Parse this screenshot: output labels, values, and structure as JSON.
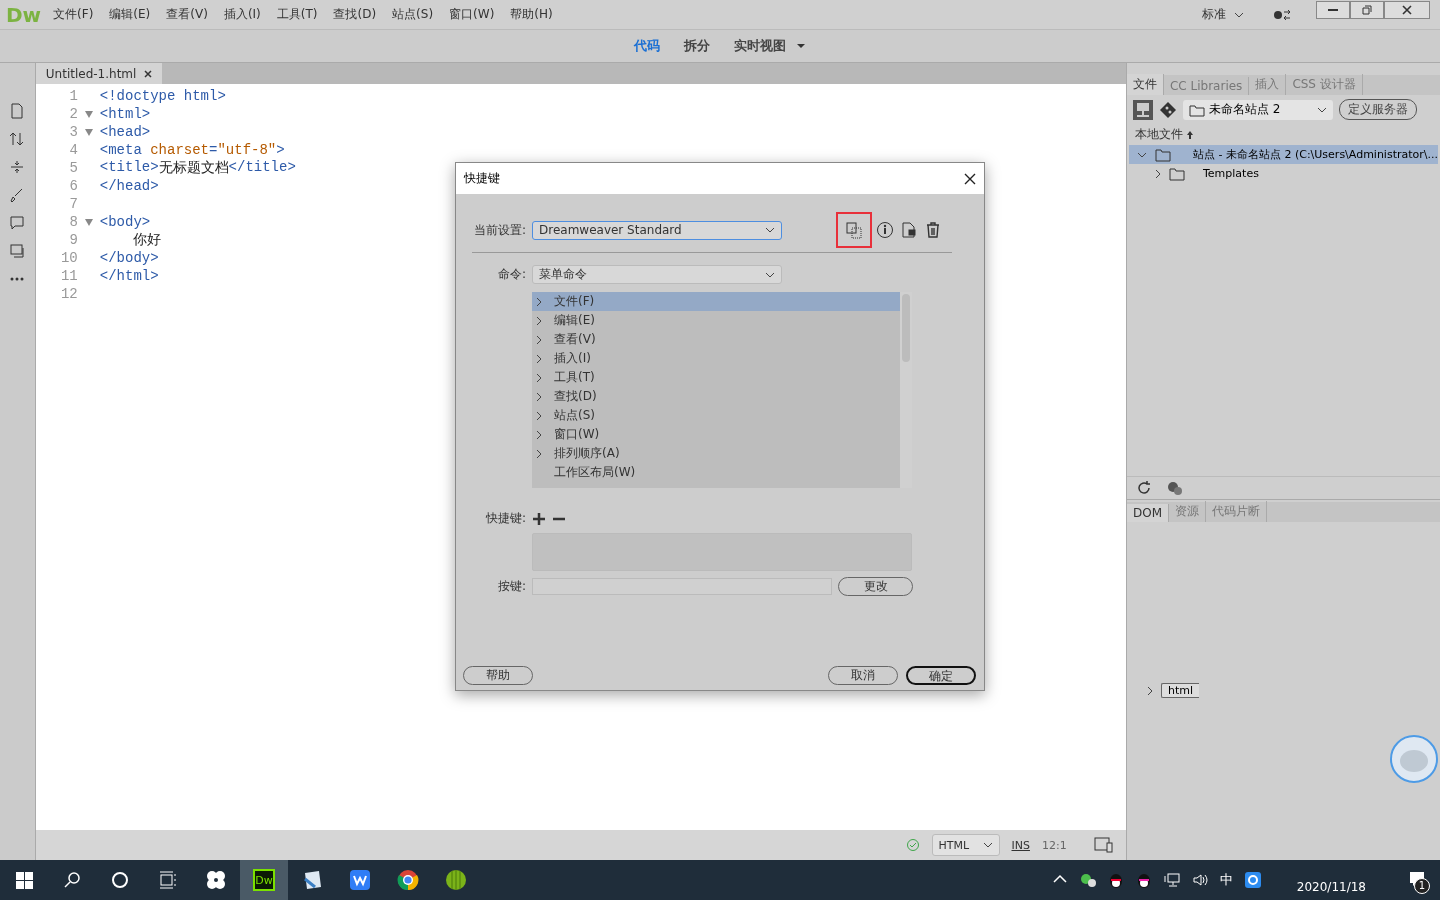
{
  "app": {
    "logo": "Dw",
    "menu": [
      "文件(F)",
      "编辑(E)",
      "查看(V)",
      "插入(I)",
      "工具(T)",
      "查找(D)",
      "站点(S)",
      "窗口(W)",
      "帮助(H)"
    ],
    "workspace": "标准"
  },
  "view_switch": [
    {
      "label": "代码",
      "selected": true
    },
    {
      "label": "拆分",
      "selected": false
    },
    {
      "label": "实时视图",
      "selected": false
    }
  ],
  "document_tab": {
    "title": "Untitled-1.html"
  },
  "code_lines": [
    {
      "number": "1",
      "foldable": false,
      "tokens": [
        {
          "kind": "tag",
          "text": "<!doctype html>"
        }
      ]
    },
    {
      "number": "2",
      "foldable": true,
      "tokens": [
        {
          "kind": "tag",
          "text": "<html>"
        }
      ]
    },
    {
      "number": "3",
      "foldable": true,
      "tokens": [
        {
          "kind": "tag",
          "text": "<head>"
        }
      ]
    },
    {
      "number": "4",
      "foldable": false,
      "tokens": [
        {
          "kind": "tag",
          "text": "<meta "
        },
        {
          "kind": "attr",
          "text": "charset"
        },
        {
          "kind": "tag",
          "text": "="
        },
        {
          "kind": "value",
          "text": "\"utf-8\""
        },
        {
          "kind": "tag",
          "text": ">"
        }
      ]
    },
    {
      "number": "5",
      "foldable": false,
      "tokens": [
        {
          "kind": "tag",
          "text": "<title>"
        },
        {
          "kind": "text",
          "text": "无标题文档"
        },
        {
          "kind": "tag",
          "text": "</title>"
        }
      ]
    },
    {
      "number": "6",
      "foldable": false,
      "tokens": [
        {
          "kind": "tag",
          "text": "</head>"
        }
      ]
    },
    {
      "number": "7",
      "foldable": false
    },
    {
      "number": "8",
      "foldable": true,
      "tokens": [
        {
          "kind": "tag",
          "text": "<body>"
        }
      ]
    },
    {
      "number": "9",
      "foldable": false,
      "tokens": [
        {
          "kind": "text",
          "text": "    你好"
        }
      ]
    },
    {
      "number": "10",
      "foldable": false,
      "tokens": [
        {
          "kind": "tag",
          "text": "</body>"
        }
      ]
    },
    {
      "number": "11",
      "foldable": false,
      "tokens": [
        {
          "kind": "tag",
          "text": "</html>"
        }
      ]
    },
    {
      "number": "12",
      "foldable": false
    }
  ],
  "status_bar": {
    "language": "HTML",
    "mode": "INS",
    "position": "12:1"
  },
  "files_panel": {
    "tabs": [
      {
        "label": "文件",
        "selected": true
      },
      {
        "label": "CC Libraries",
        "selected": false
      },
      {
        "label": "插入",
        "selected": false
      },
      {
        "label": "CSS 设计器",
        "selected": false
      }
    ],
    "site": "未命名站点 2",
    "define_server": "定义服务器",
    "header": "本地文件",
    "tree": [
      {
        "label": "站点 - 未命名站点 2 (C:\\Users\\Administrator\\...",
        "expanded": true,
        "selected": true,
        "children": [
          {
            "label": "Templates",
            "expanded": false,
            "selected": false
          }
        ]
      }
    ]
  },
  "dom_panel": {
    "tabs": [
      {
        "label": "DOM",
        "selected": true
      },
      {
        "label": "资源",
        "selected": false
      },
      {
        "label": "代码片断",
        "selected": false
      }
    ],
    "node": "html"
  },
  "dialog": {
    "title": "快捷键",
    "current_setting_label": "当前设置:",
    "current_setting": "Dreamweaver Standard",
    "tools": [
      {
        "kind": "duplicate",
        "highlighted": true
      },
      {
        "kind": "info",
        "highlighted": false
      },
      {
        "kind": "export",
        "highlighted": false
      },
      {
        "kind": "delete",
        "highlighted": false
      }
    ],
    "command_label": "命令:",
    "command": "菜单命令",
    "commands": [
      {
        "label": "文件(F)",
        "expandable": true,
        "selected": true
      },
      {
        "label": "编辑(E)",
        "expandable": true,
        "selected": false
      },
      {
        "label": "查看(V)",
        "expandable": true,
        "selected": false
      },
      {
        "label": "插入(I)",
        "expandable": true,
        "selected": false
      },
      {
        "label": "工具(T)",
        "expandable": true,
        "selected": false
      },
      {
        "label": "查找(D)",
        "expandable": true,
        "selected": false
      },
      {
        "label": "站点(S)",
        "expandable": true,
        "selected": false
      },
      {
        "label": "窗口(W)",
        "expandable": true,
        "selected": false
      },
      {
        "label": "排列顺序(A)",
        "expandable": true,
        "selected": false
      },
      {
        "label": "工作区布局(W)",
        "expandable": false,
        "selected": false
      }
    ],
    "shortcut_label": "快捷键:",
    "key_label": "按键:",
    "change": "更改",
    "help": "帮助",
    "cancel": "取消",
    "ok": "确定"
  },
  "taskbar": {
    "apps": [
      {
        "kind": "fan",
        "active": false
      },
      {
        "kind": "dw",
        "label": "Dw",
        "active": true
      },
      {
        "kind": "notepad",
        "active": false
      },
      {
        "kind": "wps",
        "active": false
      },
      {
        "kind": "chrome",
        "active": false
      },
      {
        "kind": "melon",
        "active": false
      }
    ],
    "ime": "中",
    "date": "2020/11/18",
    "notifications": "1"
  }
}
